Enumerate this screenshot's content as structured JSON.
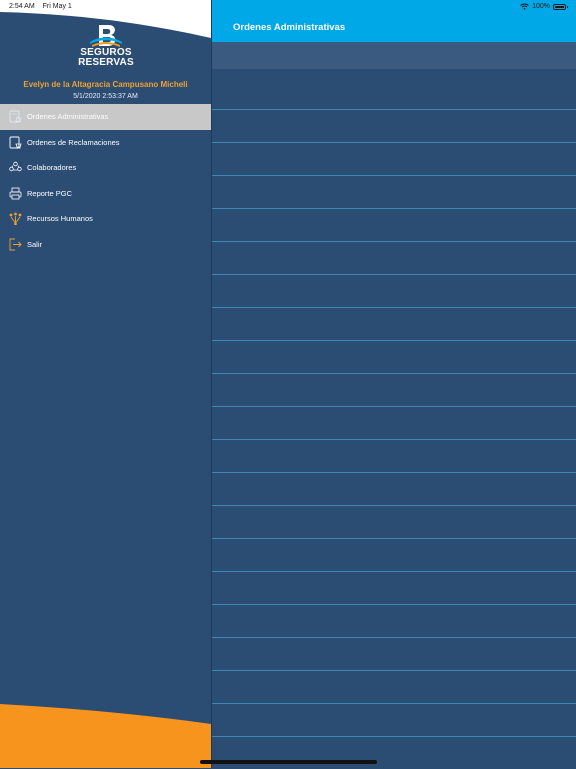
{
  "status_bar": {
    "time": "2:54 AM",
    "date": "Fri May 1",
    "battery": "100%"
  },
  "colors": {
    "nav_bar": "#00a8e8",
    "background": "#2b4d73",
    "accent_orange": "#f7941d",
    "user_name": "#f0a030",
    "selected_item": "#c8c8c8"
  },
  "brand": {
    "line1": "SEGUROS",
    "line2": "RESERVAS"
  },
  "user": {
    "name": "Evelyn de la Altagracia Campusano Micheli",
    "timestamp": "5/1/2020 2:53:37 AM"
  },
  "menu": {
    "items": [
      {
        "label": "Ordenes Administrativas",
        "icon": "admin-orders-icon",
        "selected": true
      },
      {
        "label": "Ordenes de Reclamaciones",
        "icon": "claims-orders-icon",
        "selected": false
      },
      {
        "label": "Colaboradores",
        "icon": "collaborators-icon",
        "selected": false
      },
      {
        "label": "Reporte PGC",
        "icon": "printer-icon",
        "selected": false
      },
      {
        "label": "Recursos Humanos",
        "icon": "human-resources-icon",
        "selected": false
      },
      {
        "label": "Salir",
        "icon": "logout-icon",
        "selected": false
      }
    ]
  },
  "main": {
    "title": "Ordenes Administrativas",
    "empty_row_count": 20
  }
}
